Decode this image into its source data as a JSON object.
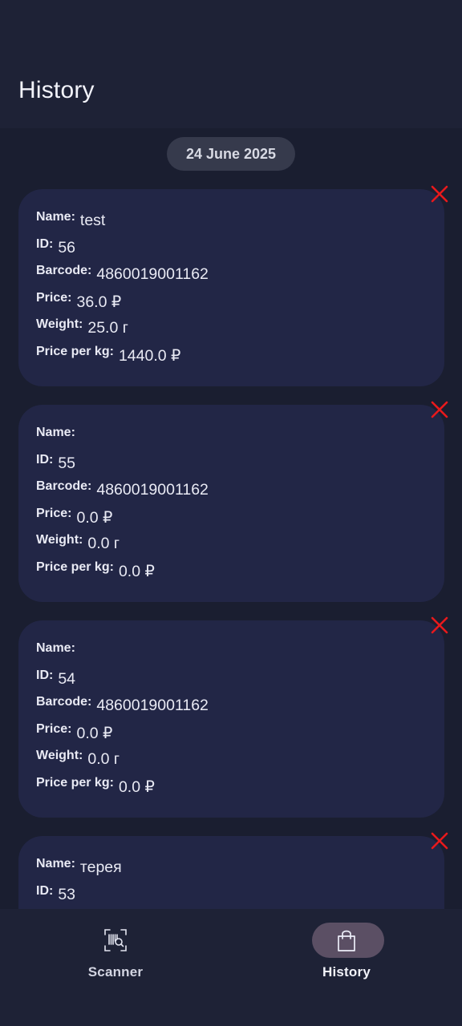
{
  "app_bar": {
    "title": "History"
  },
  "history": {
    "date_header": "24 June 2025",
    "labels": {
      "name": "Name:",
      "id": "ID:",
      "barcode": "Barcode:",
      "price": "Price:",
      "weight": "Weight:",
      "price_per_kg": "Price per kg:"
    },
    "delete_icon": "close-x-icon",
    "delete_icon_color": "#e8191c",
    "entries": [
      {
        "name": "test",
        "id": "56",
        "barcode": "4860019001162",
        "price": "36.0 ₽",
        "weight": "25.0 г",
        "price_per_kg": "1440.0 ₽"
      },
      {
        "name": "",
        "id": "55",
        "barcode": "4860019001162",
        "price": "0.0 ₽",
        "weight": "0.0 г",
        "price_per_kg": "0.0 ₽"
      },
      {
        "name": "",
        "id": "54",
        "barcode": "4860019001162",
        "price": "0.0 ₽",
        "weight": "0.0 г",
        "price_per_kg": "0.0 ₽"
      },
      {
        "name": "терея",
        "id": "53"
      }
    ]
  },
  "bottom_nav": {
    "items": [
      {
        "label": "Scanner",
        "icon": "barcode-scan-icon",
        "active": false
      },
      {
        "label": "History",
        "icon": "shopping-bag-icon",
        "active": true
      }
    ]
  },
  "colors": {
    "background": "#1a1e30",
    "bars": "#1e2236",
    "card": "#222646",
    "chip": "#363a4c",
    "active_indicator": "#5b4f64",
    "delete": "#e8191c"
  }
}
